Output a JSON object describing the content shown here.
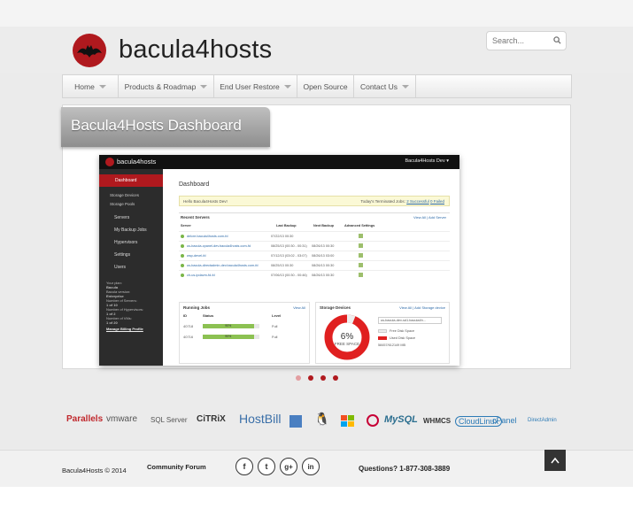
{
  "brand": {
    "name": "bacula4hosts",
    "logo_icon": "bat-logo-icon"
  },
  "search": {
    "placeholder": "Search..."
  },
  "nav": [
    {
      "label": "Home",
      "has_dropdown": true
    },
    {
      "label": "Products & Roadmap",
      "has_dropdown": true
    },
    {
      "label": "End User Restore",
      "has_dropdown": true
    },
    {
      "label": "Open Source",
      "has_dropdown": false
    },
    {
      "label": "Contact Us",
      "has_dropdown": true
    }
  ],
  "slider": {
    "title": "Bacula4Hosts Dashboard",
    "active_slide": 1,
    "slide_count": 4,
    "screenshot": {
      "brand": "bacula4hosts",
      "user": "Bacula4Hosts Dev ▾",
      "sidebar": {
        "active": "Dashboard",
        "sub": [
          "Storage Devices",
          "Storage Pools"
        ],
        "items": [
          "Servers",
          "My Backup Jobs",
          "Hypervisors",
          "Settings",
          "Users"
        ],
        "info": [
          "Your plan:",
          "Bacula",
          "Bacula version:",
          "Enterprise",
          "Number of Servers:",
          "1 of 10",
          "Number of Hypervisors:",
          "1 of 2",
          "Number of VMs:",
          "1 of 20"
        ],
        "billing": "Manage Billing Profile"
      },
      "title": "Dashboard",
      "hello": "Hello Bacula4Hosts Dev!",
      "terminated_label": "Today's Terminated Jobs:",
      "successful": "2 Successful",
      "failed": "0 Failed",
      "recent_servers": {
        "title": "Recent Servers",
        "links": "View All | Add Server",
        "headers": [
          "Server",
          "Last Backup",
          "Next Backup",
          "Advanced Settings"
        ],
        "rows": [
          {
            "name": "delcre.bacula4hosts.com-fd",
            "last": "07/22/13 00:30",
            "next": ""
          },
          {
            "name": "us-bacula-cpanel-dev.bacula4hosts.com-fd",
            "last": "08/25/13 (00:30 - 00:31)",
            "next": "08/26/13 00:30"
          },
          {
            "name": "wsp-devel-fd",
            "last": "07/12/13 (03:02 - 03:07)",
            "next": "08/26/13 03:00"
          },
          {
            "name": "us-bacula-directadmin-dev.bacula4hosts.com-fd",
            "last": "08/25/13 00:30",
            "next": "08/26/13 00:30"
          },
          {
            "name": "ch-us-ipdavm-fd-fd",
            "last": "07/06/13 (00:30 - 00:46)",
            "next": "08/26/13 00:30"
          }
        ]
      },
      "running_jobs": {
        "title": "Running Jobs",
        "link": "View All",
        "headers": [
          "ID",
          "Status",
          "Level"
        ],
        "rows": [
          {
            "id": "40718",
            "status": "90%",
            "progress": 0.9,
            "level": "Full"
          },
          {
            "id": "40716",
            "status": "90%",
            "progress": 0.9,
            "level": "Full"
          }
        ]
      },
      "storage": {
        "title": "Storage Devices",
        "links": "View All | Add Storage device",
        "selected": "us-bacula-dev-sd1.bacula4h...",
        "free_percent": "6%",
        "free_label": "FREE SPACE",
        "free_fraction": 0.06,
        "legend_free": "Free Disk Space",
        "legend_used": "Used Disk Space",
        "usage": "58457/612149 MB"
      }
    }
  },
  "partners": [
    "Parallels",
    "vmware",
    "SQL Server",
    "CiTRiX",
    "HostBill",
    "Linux",
    "Windows",
    "Debian",
    "MySQL",
    "WHMCS",
    "CloudLinux",
    "cPanel",
    "DirectAdmin"
  ],
  "footer": {
    "copyright": "Bacula4Hosts © 2014",
    "forum": "Community Forum",
    "social": [
      {
        "icon": "facebook-icon",
        "glyph": "f"
      },
      {
        "icon": "twitter-icon",
        "glyph": "t"
      },
      {
        "icon": "google-plus-icon",
        "glyph": "g+"
      },
      {
        "icon": "linkedin-icon",
        "glyph": "in"
      }
    ],
    "phone": "Questions? 1-877-308-3889"
  },
  "colors": {
    "accent": "#b0191e",
    "success": "#8cc152",
    "link": "#2d6aa8"
  }
}
